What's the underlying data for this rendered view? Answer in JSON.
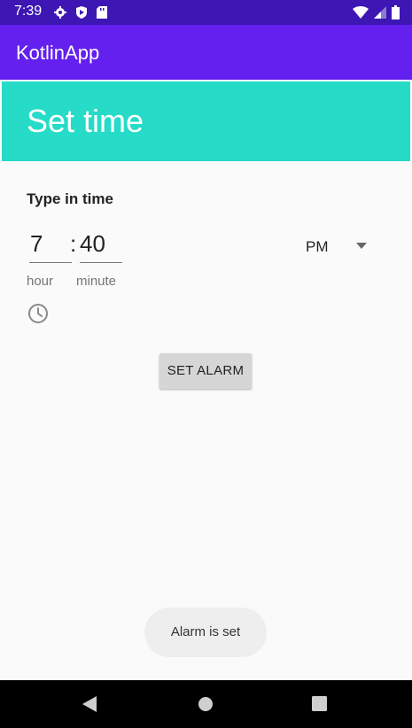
{
  "status_bar": {
    "time": "7:39",
    "left_icons": [
      "gear-icon",
      "shield-icon",
      "sd-card-icon"
    ],
    "right_icons": [
      "wifi-icon",
      "cell-signal-icon",
      "battery-icon"
    ]
  },
  "app_bar": {
    "title": "KotlinApp"
  },
  "header": {
    "title": "Set time"
  },
  "form": {
    "type_label": "Type in time",
    "hour_value": "7",
    "separator": ":",
    "minute_value": "40",
    "hour_label": "hour",
    "minute_label": "minute",
    "ampm_value": "PM"
  },
  "actions": {
    "set_alarm_label": "SET ALARM"
  },
  "toast": {
    "message": "Alarm is set"
  },
  "colors": {
    "status_bar": "#3d16b4",
    "app_bar": "#6320ee",
    "header": "#26dbc7",
    "button": "#d6d6d6",
    "toast": "#eeeeee",
    "nav_bar": "#000000"
  }
}
